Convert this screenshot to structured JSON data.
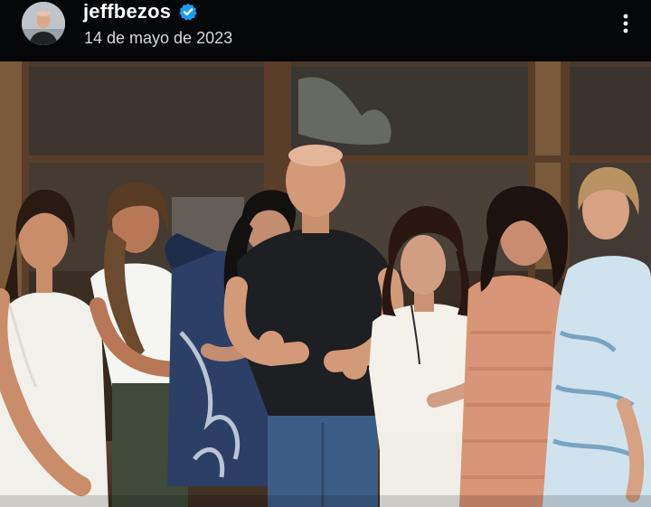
{
  "post": {
    "username": "jeffbezos",
    "date": "14 de mayo de 2023",
    "verified": true
  },
  "icons": {
    "avatar": "profile-avatar",
    "verified": "verified-badge-icon",
    "more": "more-vertical-icon"
  },
  "colors": {
    "header_bg": "#050608",
    "verified_blue": "#1d9bf0",
    "text_primary": "#ffffff",
    "text_secondary": "#d6d8db"
  }
}
